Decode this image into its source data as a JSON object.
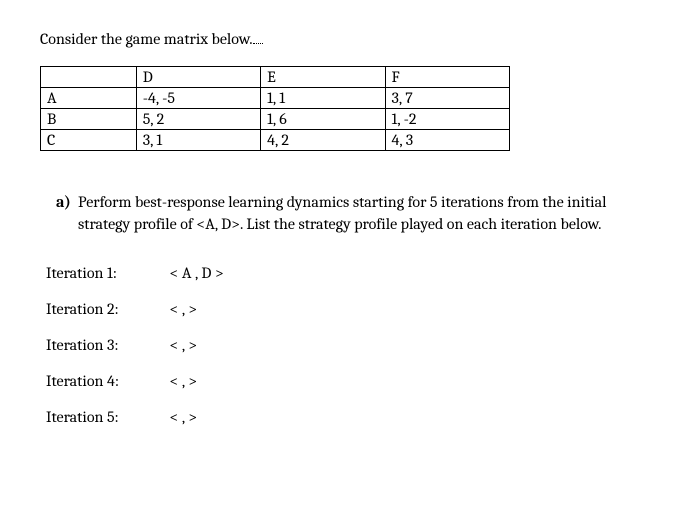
{
  "intro": "Consider the game matrix below.",
  "matrix": {
    "colHeaders": [
      "",
      "D",
      "E",
      "F"
    ],
    "rows": [
      {
        "label": "A",
        "cells": [
          "-4, -5",
          "1, 1",
          "3, 7"
        ]
      },
      {
        "label": "B",
        "cells": [
          "5, 2",
          "1, 6",
          "1, -2"
        ]
      },
      {
        "label": "C",
        "cells": [
          "3, 1",
          "4, 2",
          "4, 3"
        ]
      }
    ]
  },
  "question": {
    "label": "a)",
    "text": "Perform best-response learning dynamics starting for 5 iterations from the initial strategy profile of <A, D>. List the strategy profile played on each iteration below."
  },
  "iterations": [
    {
      "label": "Iteration 1:",
      "value": "<  A  ,  D  >"
    },
    {
      "label": "Iteration 2:",
      "value": "<       ,       >"
    },
    {
      "label": "Iteration 3:",
      "value": "<       ,       >"
    },
    {
      "label": "Iteration 4:",
      "value": "<       ,       >"
    },
    {
      "label": "Iteration 5:",
      "value": "<       ,       >"
    }
  ]
}
